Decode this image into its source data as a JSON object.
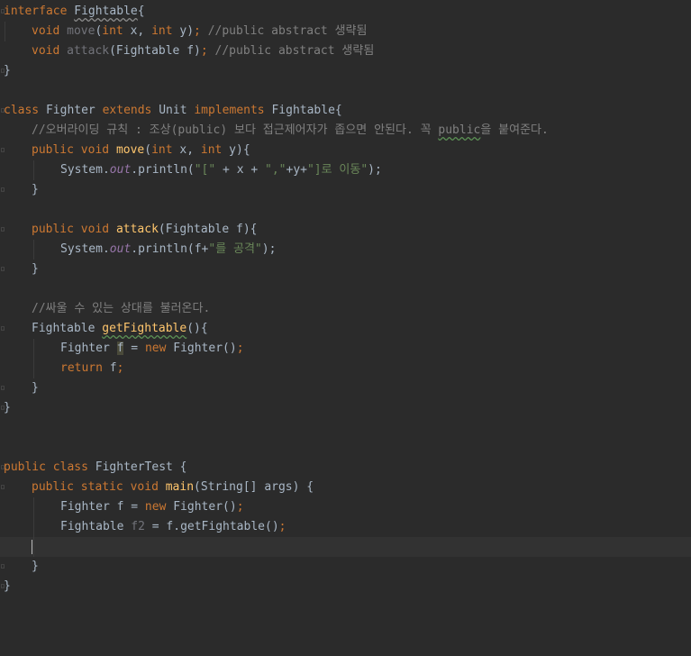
{
  "editor": {
    "lines": {
      "l0": {
        "kw1": "interface",
        "name": "Fightable",
        "rest": "{"
      },
      "l1": {
        "t1": "void",
        "t2": "move",
        "t3": "(",
        "t4": "int",
        "t5": " x, ",
        "t6": "int",
        "t7": " y)",
        "t8": ";",
        "t9": " //public abstract 생략됨"
      },
      "l2": {
        "t1": "void",
        "t2": "attack",
        "t3": "(Fightable f)",
        "t4": ";",
        "t5": " //public abstract 생략됨"
      },
      "l3": {
        "t1": "}"
      },
      "l5": {
        "t1": "class",
        "t2": " Fighter ",
        "t3": "extends",
        "t4": " Unit ",
        "t5": "implements",
        "t6": " Fightable{"
      },
      "l6": {
        "t1": "//오버라이딩 규칙 : 조상(public) 보다 접근제어자가 좁으면 안된다. 꼭 ",
        "t2": "public",
        "t3": "을 붙여준다."
      },
      "l7": {
        "t1": "public",
        "t2": " ",
        "t3": "void",
        "t4": " ",
        "t5": "move",
        "t6": "(",
        "t7": "int",
        "t8": " x, ",
        "t9": "int",
        "t10": " y){"
      },
      "l8": {
        "t1": "System.",
        "t2": "out",
        "t3": ".println(",
        "t4": "\"[\"",
        "t5": " + x + ",
        "t6": "\",\"",
        "t7": "+y+",
        "t8": "\"]로 이동\"",
        "t9": ");"
      },
      "l9": {
        "t1": "}"
      },
      "l11": {
        "t1": "public",
        "t2": " ",
        "t3": "void",
        "t4": " ",
        "t5": "attack",
        "t6": "(Fightable f){"
      },
      "l12": {
        "t1": "System.",
        "t2": "out",
        "t3": ".println(f+",
        "t4": "\"를 공격\"",
        "t5": ");"
      },
      "l13": {
        "t1": "}"
      },
      "l15": {
        "t1": "//싸울 수 있는 상대를 불러온다."
      },
      "l16": {
        "t1": "Fightable ",
        "t2": "getFightable",
        "t3": "(){"
      },
      "l17": {
        "t1": "Fighter ",
        "t2": "f",
        "t3": " = ",
        "t4": "new",
        "t5": " Fighter()",
        "t6": ";"
      },
      "l18": {
        "t1": "return",
        "t2": " f",
        "t3": ";"
      },
      "l19": {
        "t1": "}"
      },
      "l20": {
        "t1": "}"
      },
      "l23": {
        "t1": "public",
        "t2": " ",
        "t3": "class",
        "t4": " FighterTest {"
      },
      "l24": {
        "t1": "public",
        "t2": " ",
        "t3": "static",
        "t4": " ",
        "t5": "void",
        "t6": " ",
        "t7": "main",
        "t8": "(String[] args) {"
      },
      "l25": {
        "t1": "Fighter f = ",
        "t2": "new",
        "t3": " Fighter()",
        "t4": ";"
      },
      "l26": {
        "t1": "Fightable ",
        "t2": "f2",
        "t3": " = f.getFightable()",
        "t4": ";"
      },
      "l28": {
        "t1": "}"
      },
      "l29": {
        "t1": "}"
      }
    },
    "gutter_marker": "▫"
  },
  "colors": {
    "background": "#2b2b2b",
    "keyword": "#cc7832",
    "method": "#ffc66d",
    "comment": "#808080",
    "string": "#6a8759",
    "field": "#9876aa",
    "text": "#a9b7c6"
  }
}
